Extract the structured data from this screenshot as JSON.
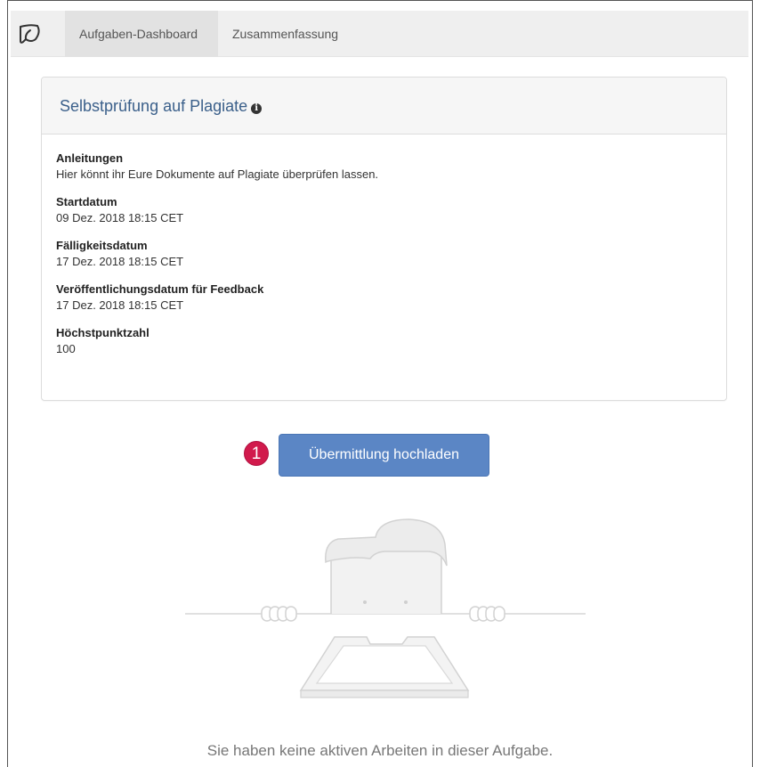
{
  "nav": {
    "tabs": [
      {
        "label": "Aufgaben-Dashboard",
        "active": true
      },
      {
        "label": "Zusammenfassung",
        "active": false
      }
    ]
  },
  "panel": {
    "title": "Selbstprüfung auf Plagiate",
    "fields": [
      {
        "label": "Anleitungen",
        "value": "Hier könnt ihr Eure Dokumente auf Plagiate überprüfen lassen."
      },
      {
        "label": "Startdatum",
        "value": "09 Dez. 2018 18:15 CET"
      },
      {
        "label": "Fälligkeitsdatum",
        "value": "17 Dez. 2018 18:15 CET"
      },
      {
        "label": "Veröffentlichungsdatum für Feedback",
        "value": "17 Dez. 2018 18:15 CET"
      },
      {
        "label": "Höchstpunktzahl",
        "value": "100"
      }
    ]
  },
  "upload": {
    "badge": "1",
    "button_label": "Übermittlung hochladen"
  },
  "empty_state": {
    "message": "Sie haben keine aktiven Arbeiten in dieser Aufgabe."
  },
  "colors": {
    "accent": "#5b86c5",
    "badge": "#d11a4c",
    "title": "#3a5f8a"
  }
}
